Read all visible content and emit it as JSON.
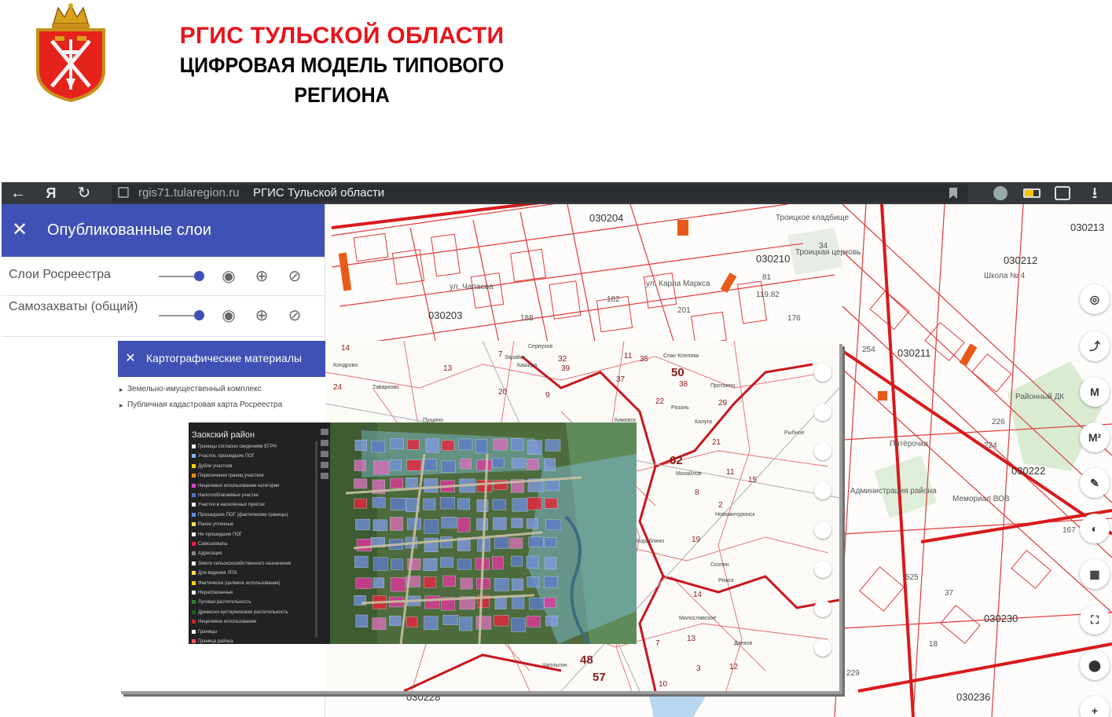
{
  "slide": {
    "title_line1": "РГИС ТУЛЬСКОЙ ОБЛАСТИ",
    "title_line2": "ЦИФРОВАЯ МОДЕЛЬ ТИПОВОГО",
    "title_line3": "РЕГИОНА"
  },
  "browser": {
    "url_domain": "rgis71.tularegion.ru",
    "page_title": "РГИС Тульской области",
    "back_glyph": "←",
    "yandex_glyph": "Я",
    "reload_glyph": "↻",
    "download_glyph": "⭳"
  },
  "panel": {
    "title": "Опубликованные слои",
    "close_glyph": "✕",
    "layers": [
      {
        "name": "Слои Росреестра",
        "opacity": 1.0
      },
      {
        "name": "Самозахваты (общий)",
        "opacity": 1.0
      }
    ]
  },
  "inset": {
    "title": "Картографические материалы",
    "close_glyph": "✕",
    "items": [
      "Земельно-имущественный комплекс",
      "Публичная кадастровая карта Росреестра"
    ],
    "map_labels": [
      {
        "t": "14"
      },
      {
        "t": "7"
      },
      {
        "t": "Серпухов"
      },
      {
        "t": "32"
      },
      {
        "t": "35"
      },
      {
        "t": "50"
      },
      {
        "t": "38"
      },
      {
        "t": "37"
      },
      {
        "t": "13"
      },
      {
        "t": "20"
      },
      {
        "t": "24"
      },
      {
        "t": "Кондрово"
      },
      {
        "t": "Таварково"
      },
      {
        "t": "9"
      },
      {
        "t": "22"
      },
      {
        "t": "Рязань"
      },
      {
        "t": "29"
      },
      {
        "t": "15"
      },
      {
        "t": "62"
      },
      {
        "t": "Михайлов"
      },
      {
        "t": "8"
      },
      {
        "t": "11"
      },
      {
        "t": "21"
      },
      {
        "t": "2"
      },
      {
        "t": "Новомичуринск"
      },
      {
        "t": "Кораблино"
      },
      {
        "t": "19"
      },
      {
        "t": "Скопин"
      },
      {
        "t": "Ряжск"
      },
      {
        "t": "14"
      },
      {
        "t": "Милославское"
      },
      {
        "t": "7"
      },
      {
        "t": "13"
      },
      {
        "t": "3"
      },
      {
        "t": "Данков"
      },
      {
        "t": "12"
      },
      {
        "t": "Чаплыгин"
      },
      {
        "t": "48"
      },
      {
        "t": "57"
      },
      {
        "t": "10"
      },
      {
        "t": "Ефремов"
      },
      {
        "t": "Лебедянь"
      },
      {
        "t": "Узловая"
      },
      {
        "t": "Кимовск"
      },
      {
        "t": "Серебряные Пруды"
      },
      {
        "t": "39"
      },
      {
        "t": "11"
      },
      {
        "t": "Кашира"
      },
      {
        "t": "Зарайск"
      },
      {
        "t": "Пущино"
      },
      {
        "t": "Протвино"
      },
      {
        "t": "Калуга"
      },
      {
        "t": "Рыбное"
      },
      {
        "t": "Спас-Клепики"
      }
    ]
  },
  "legend": {
    "title": "Заокский район",
    "items": [
      {
        "text": "Границы согласно сведениям ЕГРН",
        "color": "#ffffff"
      },
      {
        "text": "Участки, прошедшие ПОГ",
        "color": "#8ab4ff"
      },
      {
        "text": "Дубли участков",
        "color": "#ffd400"
      },
      {
        "text": "Пересечения границ участков",
        "color": "#ff8a00"
      },
      {
        "text": "Нецелевое использование категории",
        "color": "#e040e0"
      },
      {
        "text": "Налогооблагаемые участки",
        "color": "#4a7ad0"
      },
      {
        "text": "Участки в населённых пунктах",
        "color": "#ffffff"
      },
      {
        "text": "Прошедшие ПОГ (фактические границы)",
        "color": "#5a8cff"
      },
      {
        "text": "Ранее учтенные",
        "color": "#ffe14a"
      },
      {
        "text": "Не прошедшие ПОГ",
        "color": "#ffffff"
      },
      {
        "text": "Самозахваты",
        "color": "#ff1744"
      },
      {
        "text": "Адресация",
        "color": "#888888"
      },
      {
        "text": "Земли сельскохозяйственного назначения",
        "color": "#ffffff"
      },
      {
        "text": "Для ведения ЛПХ",
        "color": "#ffe14a"
      },
      {
        "text": "Фактически (целевое использование)",
        "color": "#ffd400"
      },
      {
        "text": "Нераспаханные",
        "color": "#ffffff"
      },
      {
        "text": "Луговая растительность",
        "color": "#2e7d32"
      },
      {
        "text": "Древесно-кустарниковая растительность",
        "color": "#1b5e20"
      },
      {
        "text": "Нецелевое использование",
        "color": "#c62828"
      },
      {
        "text": "Границы",
        "color": "#ffffff"
      },
      {
        "text": "Граница района",
        "color": "#ff5252"
      }
    ]
  },
  "map": {
    "labels": [
      {
        "t": "030204"
      },
      {
        "t": "030213"
      },
      {
        "t": "030210"
      },
      {
        "t": "030212"
      },
      {
        "t": "030203"
      },
      {
        "t": "030211"
      },
      {
        "t": "030222"
      },
      {
        "t": "030230"
      },
      {
        "t": "030228"
      },
      {
        "t": "030236"
      },
      {
        "t": "ул. Карла Маркса"
      },
      {
        "t": "ул. Чапаева"
      },
      {
        "t": "Троицкое кладбище"
      },
      {
        "t": "Троицкая церковь"
      },
      {
        "t": "Школа № 4"
      },
      {
        "t": "Районный ДК"
      },
      {
        "t": "Пятёрочка"
      },
      {
        "t": "Мемориал ВОВ"
      },
      {
        "t": "Администрация района"
      },
      {
        "t": "34"
      },
      {
        "t": "81"
      },
      {
        "t": "119.82"
      },
      {
        "t": "188"
      },
      {
        "t": "182"
      },
      {
        "t": "201"
      },
      {
        "t": "176"
      },
      {
        "t": "254"
      },
      {
        "t": "525"
      },
      {
        "t": "167"
      },
      {
        "t": "229"
      },
      {
        "t": "226"
      },
      {
        "t": "224"
      },
      {
        "t": "37"
      },
      {
        "t": "18"
      },
      {
        "t": "5"
      }
    ]
  },
  "rtools": {
    "buttons": [
      {
        "name": "locate",
        "glyph": "◎"
      },
      {
        "name": "external",
        "glyph": "⤴"
      },
      {
        "name": "measure-length",
        "glyph": "М"
      },
      {
        "name": "measure-area",
        "glyph": "М²"
      },
      {
        "name": "draw",
        "glyph": "✎"
      },
      {
        "name": "shapes",
        "glyph": "◐"
      },
      {
        "name": "calendar",
        "glyph": "▦"
      },
      {
        "name": "fullscreen",
        "glyph": "⛶"
      },
      {
        "name": "marker",
        "glyph": "⬤"
      },
      {
        "name": "zoom-in",
        "glyph": "+"
      },
      {
        "name": "zoom-out",
        "glyph": "−"
      }
    ]
  }
}
